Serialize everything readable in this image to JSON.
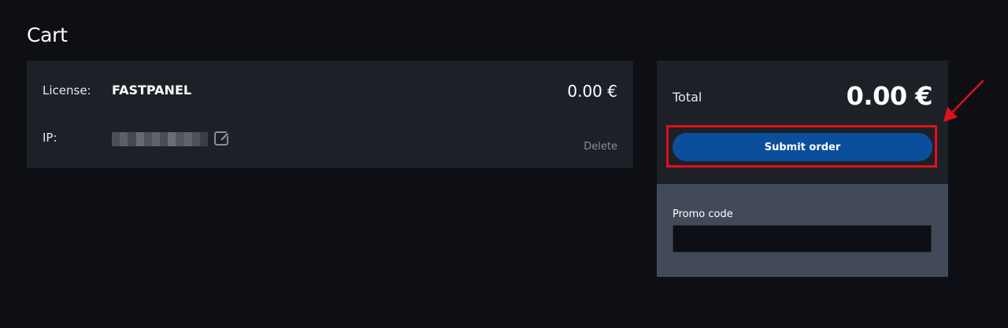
{
  "page": {
    "title": "Cart"
  },
  "cart_item": {
    "license_label": "License:",
    "license_value": "FASTPANEL",
    "price": "0.00 €",
    "ip_label": "IP:",
    "delete_label": "Delete"
  },
  "summary": {
    "total_label": "Total",
    "total_value": "0.00 €",
    "submit_label": "Submit order"
  },
  "promo": {
    "label": "Promo code",
    "value": "",
    "placeholder": ""
  },
  "colors": {
    "background": "#0e0f14",
    "card": "#1e2028",
    "promo_panel": "#424a5a",
    "button": "#0b4f9c",
    "annotation": "#e0101a"
  }
}
